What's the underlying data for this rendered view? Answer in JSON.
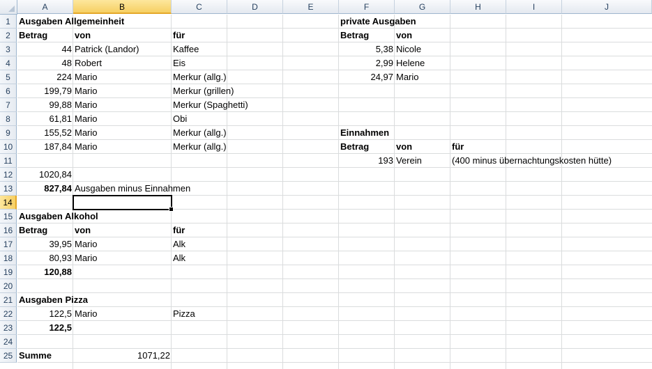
{
  "columns": [
    "A",
    "B",
    "C",
    "D",
    "E",
    "F",
    "G",
    "H",
    "I",
    "J"
  ],
  "rows": [
    "1",
    "2",
    "3",
    "4",
    "5",
    "6",
    "7",
    "8",
    "9",
    "10",
    "11",
    "12",
    "13",
    "14",
    "15",
    "16",
    "17",
    "18",
    "19",
    "20",
    "21",
    "22",
    "23",
    "24",
    "25"
  ],
  "active_column": "B",
  "active_row": "14",
  "cells": {
    "r1_a": "Ausgaben Allgemeinheit",
    "r1_f": "private Ausgaben",
    "r2_a": "Betrag",
    "r2_b": "von",
    "r2_c": "für",
    "r2_f": "Betrag",
    "r2_g": "von",
    "r3_a": "44",
    "r3_b": "Patrick (Landor)",
    "r3_c": "Kaffee",
    "r3_f": "5,38",
    "r3_g": "Nicole",
    "r4_a": "48",
    "r4_b": "Robert",
    "r4_c": "Eis",
    "r4_f": "2,99",
    "r4_g": "Helene",
    "r5_a": "224",
    "r5_b": "Mario",
    "r5_c": "Merkur (allg.)",
    "r5_f": "24,97",
    "r5_g": "Mario",
    "r6_a": "199,79",
    "r6_b": "Mario",
    "r6_c": "Merkur (grillen)",
    "r7_a": "99,88",
    "r7_b": "Mario",
    "r7_c": "Merkur (Spaghetti)",
    "r8_a": "61,81",
    "r8_b": "Mario",
    "r8_c": "Obi",
    "r9_a": "155,52",
    "r9_b": "Mario",
    "r9_c": "Merkur (allg.)",
    "r9_f": "Einnahmen",
    "r10_a": "187,84",
    "r10_b": "Mario",
    "r10_c": "Merkur (allg.)",
    "r10_f": "Betrag",
    "r10_g": "von",
    "r10_h": "für",
    "r11_f": "193",
    "r11_g": "Verein",
    "r11_h": "(400 minus übernachtungskosten hütte)",
    "r12_a": "1020,84",
    "r13_a": "827,84",
    "r13_b": "Ausgaben minus Einnahmen",
    "r15_a": "Ausgaben Alkohol",
    "r16_a": "Betrag",
    "r16_b": "von",
    "r16_c": "für",
    "r17_a": "39,95",
    "r17_b": "Mario",
    "r17_c": "Alk",
    "r18_a": "80,93",
    "r18_b": "Mario",
    "r18_c": "Alk",
    "r19_a": "120,88",
    "r21_a": "Ausgaben Pizza",
    "r22_a": "122,5",
    "r22_b": "Mario",
    "r22_c": "Pizza",
    "r23_a": "122,5",
    "r25_a": "Summe",
    "r25_b": "1071,22"
  }
}
